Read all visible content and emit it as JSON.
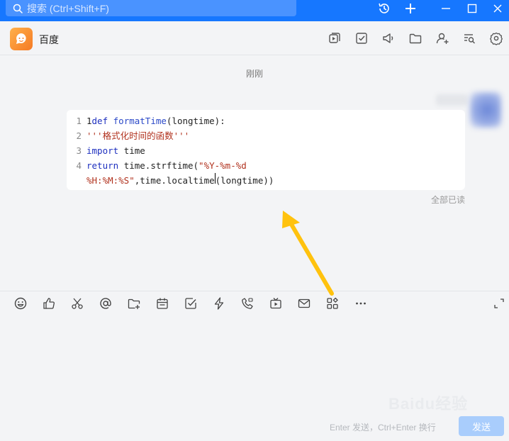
{
  "topbar": {
    "search_placeholder": "搜索 (Ctrl+Shift+F)",
    "icons": [
      "history-icon",
      "plus-icon",
      "minimize-icon",
      "maximize-icon",
      "close-icon"
    ]
  },
  "header": {
    "title": "百度",
    "icons": [
      "screen-share-icon",
      "task-icon",
      "announcement-icon",
      "folder-icon",
      "add-member-icon",
      "chat-search-icon",
      "settings-icon"
    ]
  },
  "messages": {
    "timestamp": "刚刚",
    "read_status": "全部已读",
    "code_lines": [
      {
        "num": "1",
        "parts": [
          {
            "t": "1",
            "c": "plain"
          },
          {
            "t": "def ",
            "c": "kw"
          },
          {
            "t": "formatTime",
            "c": "fn"
          },
          {
            "t": "(longtime):",
            "c": "plain"
          }
        ]
      },
      {
        "num": "2",
        "parts": [
          {
            "t": "'''格式化时间的函数'''",
            "c": "str"
          }
        ]
      },
      {
        "num": "3",
        "parts": [
          {
            "t": "import ",
            "c": "kw"
          },
          {
            "t": "time",
            "c": "plain"
          }
        ]
      },
      {
        "num": "4",
        "parts": [
          {
            "t": "return ",
            "c": "kw"
          },
          {
            "t": "time.strftime(",
            "c": "plain"
          },
          {
            "t": "\"%Y-%m-%d",
            "c": "str"
          }
        ]
      },
      {
        "num": "",
        "parts": [
          {
            "t": "%H:%M:%S\"",
            "c": "str"
          },
          {
            "t": ",time.localtime",
            "c": "plain"
          },
          {
            "t": "|",
            "c": "cursor"
          },
          {
            "t": "(longtime))",
            "c": "plain"
          }
        ]
      }
    ]
  },
  "toolbar": {
    "icons": [
      "emoji-icon",
      "thumbs-up-icon",
      "scissors-icon",
      "at-icon",
      "folder-add-icon",
      "calendar-icon",
      "checkbox-icon",
      "lightning-icon",
      "phone-icon",
      "tv-icon",
      "mail-icon",
      "apps-icon",
      "more-icon",
      "expand-icon"
    ]
  },
  "footer": {
    "hint": "Enter 发送，Ctrl+Enter 换行",
    "send_label": "发送"
  },
  "watermark": "Baidu经验",
  "colors": {
    "accent": "#1677ff",
    "arrow": "#ffc20e",
    "send_disabled": "#a9cdfc"
  }
}
